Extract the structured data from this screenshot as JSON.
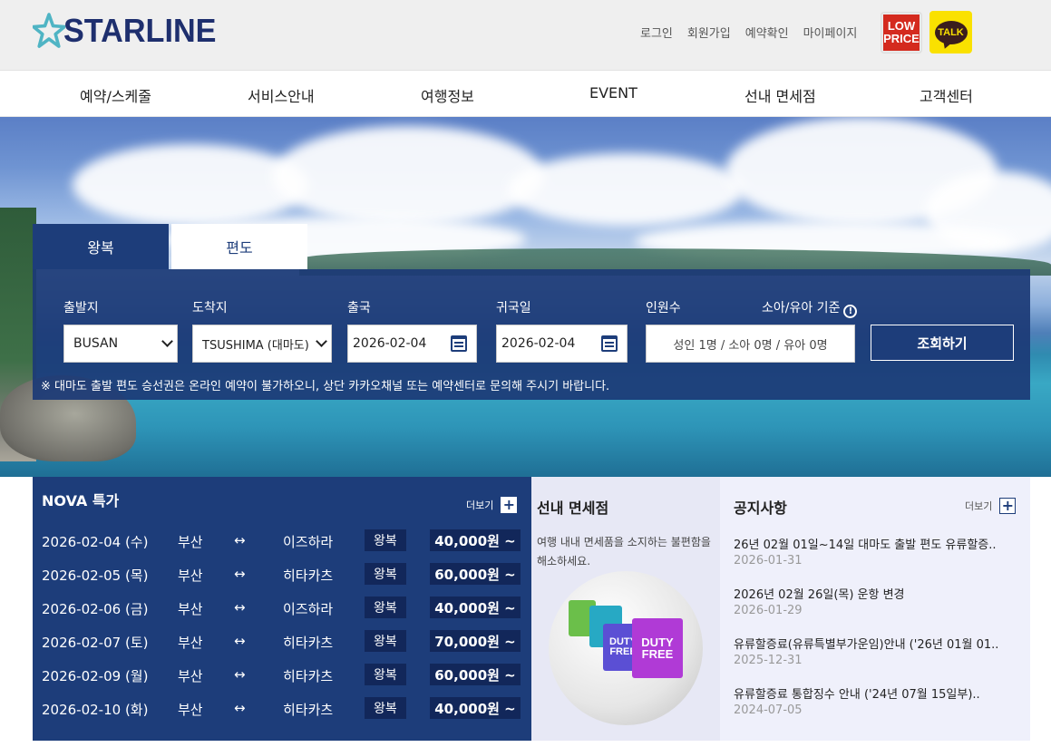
{
  "header": {
    "logo_text": "STARLINE",
    "util_links": [
      "로그인",
      "회원가입",
      "예약확인",
      "마이페이지"
    ],
    "badge_low_line1": "LOW",
    "badge_low_line2": "PRICE",
    "badge_talk": "TALK"
  },
  "nav": [
    "예약/스케줄",
    "서비스안내",
    "여행정보",
    "EVENT",
    "선내 면세점",
    "고객센터"
  ],
  "booking": {
    "tabs": [
      "왕복",
      "편도"
    ],
    "labels": {
      "departure": "출발지",
      "arrival": "도착지",
      "outbound": "출국",
      "return": "귀국일",
      "passengers": "인원수",
      "child_info": "소아/유아 기준"
    },
    "departure_value": "BUSAN",
    "arrival_value": "TSUSHIMA (대마도)",
    "outbound_date": "2026-02-04",
    "return_date": "2026-02-04",
    "passengers_value": "성인 1명 / 소아 0명 / 유아 0명",
    "search_button": "조회하기",
    "notice": "※ 대마도 출발 편도 승선권은 온라인 예약이 불가하오니, 상단 카카오채널 또는 예약센터로 문의해 주시기 바랍니다."
  },
  "nova": {
    "title": "NOVA 특가",
    "more": "더보기",
    "deals": [
      {
        "date": "2026-02-04 (수)",
        "from": "부산",
        "arrow": "↔",
        "to": "이즈하라",
        "trip": "왕복",
        "price": "40,000원 ~"
      },
      {
        "date": "2026-02-05 (목)",
        "from": "부산",
        "arrow": "↔",
        "to": "히타카츠",
        "trip": "왕복",
        "price": "60,000원 ~"
      },
      {
        "date": "2026-02-06 (금)",
        "from": "부산",
        "arrow": "↔",
        "to": "이즈하라",
        "trip": "왕복",
        "price": "40,000원 ~"
      },
      {
        "date": "2026-02-07 (토)",
        "from": "부산",
        "arrow": "↔",
        "to": "히타카츠",
        "trip": "왕복",
        "price": "70,000원 ~"
      },
      {
        "date": "2026-02-09 (월)",
        "from": "부산",
        "arrow": "↔",
        "to": "히타카츠",
        "trip": "왕복",
        "price": "60,000원 ~"
      },
      {
        "date": "2026-02-10 (화)",
        "from": "부산",
        "arrow": "↔",
        "to": "히타카츠",
        "trip": "왕복",
        "price": "40,000원 ~"
      }
    ]
  },
  "duty_free": {
    "title": "선내 면세점",
    "desc": "여행 내내 면세품을 소지하는 불편함을 해소하세요.",
    "bag_text_1": "DUTY FREE",
    "bag_text_2": "DUTY FREE"
  },
  "notices": {
    "title": "공지사항",
    "more": "더보기",
    "items": [
      {
        "title": "26년 02월 01일~14일 대마도 출발 편도 유류할증..",
        "date": "2026-01-31"
      },
      {
        "title": "2026년 02월 26일(목) 운항 변경",
        "date": "2026-01-29"
      },
      {
        "title": "유류할증료(유류특별부가운임)안내 ('26년 01월 01..",
        "date": "2025-12-31"
      },
      {
        "title": "유류할증료 통합징수 안내 ('24년 07월 15일부)..",
        "date": "2024-07-05"
      }
    ]
  },
  "colors": {
    "brand_navy": "#1d3d7a",
    "logo_star": "#4fb4c4",
    "low_price_red": "#d42a1e",
    "kakao_yellow": "#fae100"
  }
}
